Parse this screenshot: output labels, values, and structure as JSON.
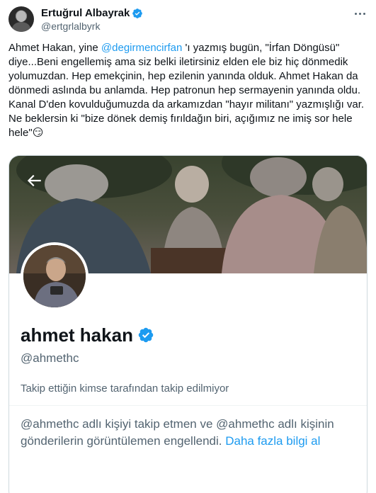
{
  "tweet": {
    "author": {
      "display_name": "Ertuğrul Albayrak",
      "handle": "@ertgrlalbyrk",
      "verified_icon": "verified-badge-icon"
    },
    "text_before_mention": "Ahmet Hakan, yine ",
    "mention": "@degirmencirfan",
    "text_after_mention": " 'ı yazmış bugün, \"İrfan Döngüsü\" diye...Beni engellemiş ama siz belki iletirsiniz elden ele biz hiç dönmedik yolumuzdan. Hep emekçinin, hep ezilenin yanında olduk. Ahmet Hakan da dönmedi aslında bu anlamda. Hep patronun hep sermayenin yanında oldu. Kanal D'den kovulduğumuzda da arkamızdan \"hayır militanı\" yazmışlığı var. Ne beklersin ki \"bize dönek demiş fırıldağın biri, açığımız ne imiş sor hele hele\"",
    "emoji": "😏"
  },
  "embedded_profile": {
    "name": "ahmet hakan",
    "handle": "@ahmethc",
    "follow_note": "Takip ettiğin kimse tarafından takip edilmiyor",
    "block_message": "@ahmethc adlı kişiyi takip etmen ve @ahmethc adlı kişinin gönderilerin görüntülemen engellendi.",
    "learn_more": "Daha fazla bilgi al"
  },
  "colors": {
    "accent": "#1d9bf0",
    "text_primary": "#0f1419",
    "text_secondary": "#536471",
    "border": "#cfd9de"
  },
  "icons": [
    "more-options-icon",
    "verified-badge-icon",
    "back-arrow-icon"
  ]
}
